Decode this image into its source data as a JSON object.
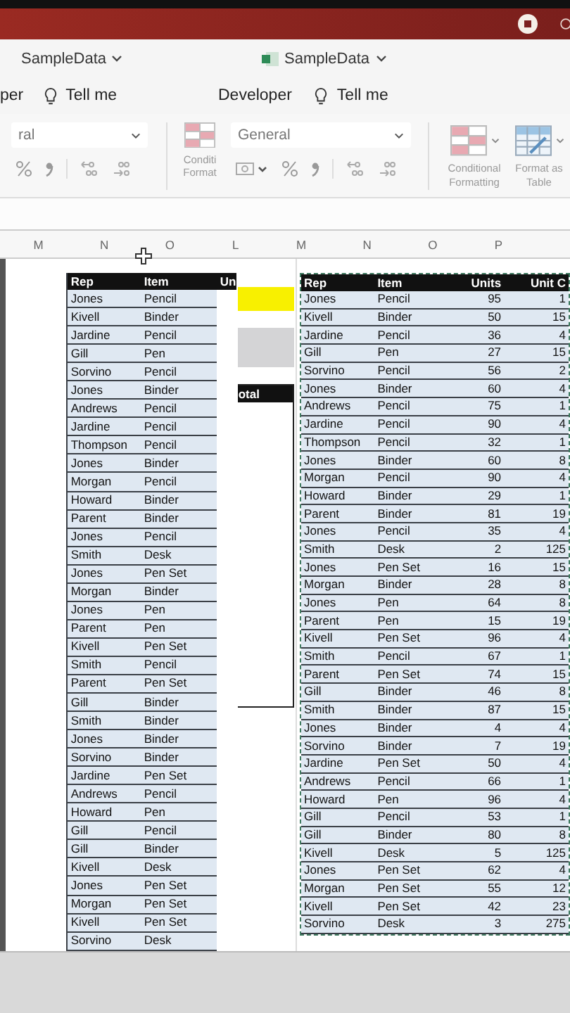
{
  "left_window": {
    "title": "SampleData",
    "tab_partial": "per",
    "tell_me": "Tell me",
    "number_format": "ral",
    "table": {
      "columns": [
        "Rep",
        "Item",
        "Un"
      ],
      "rows": [
        [
          "Jones",
          "Pencil"
        ],
        [
          "Kivell",
          "Binder"
        ],
        [
          "Jardine",
          "Pencil"
        ],
        [
          "Gill",
          "Pen"
        ],
        [
          "Sorvino",
          "Pencil"
        ],
        [
          "Jones",
          "Binder"
        ],
        [
          "Andrews",
          "Pencil"
        ],
        [
          "Jardine",
          "Pencil"
        ],
        [
          "Thompson",
          "Pencil"
        ],
        [
          "Jones",
          "Binder"
        ],
        [
          "Morgan",
          "Pencil"
        ],
        [
          "Howard",
          "Binder"
        ],
        [
          "Parent",
          "Binder"
        ],
        [
          "Jones",
          "Pencil"
        ],
        [
          "Smith",
          "Desk"
        ],
        [
          "Jones",
          "Pen Set"
        ],
        [
          "Morgan",
          "Binder"
        ],
        [
          "Jones",
          "Pen"
        ],
        [
          "Parent",
          "Pen"
        ],
        [
          "Kivell",
          "Pen Set"
        ],
        [
          "Smith",
          "Pencil"
        ],
        [
          "Parent",
          "Pen Set"
        ],
        [
          "Gill",
          "Binder"
        ],
        [
          "Smith",
          "Binder"
        ],
        [
          "Jones",
          "Binder"
        ],
        [
          "Sorvino",
          "Binder"
        ],
        [
          "Jardine",
          "Pen Set"
        ],
        [
          "Andrews",
          "Pencil"
        ],
        [
          "Howard",
          "Pen"
        ],
        [
          "Gill",
          "Pencil"
        ],
        [
          "Gill",
          "Binder"
        ],
        [
          "Kivell",
          "Desk"
        ],
        [
          "Jones",
          "Pen Set"
        ],
        [
          "Morgan",
          "Pen Set"
        ],
        [
          "Kivell",
          "Pen Set"
        ],
        [
          "Sorvino",
          "Desk"
        ]
      ]
    },
    "total_header": "otal"
  },
  "right_window": {
    "title": "SampleData",
    "tab": "Developer",
    "tell_me": "Tell me",
    "conditional_short": [
      "Conditi",
      "Format"
    ],
    "number_format": "General",
    "conditional_formatting": "Conditional Formatting",
    "format_as_table": "Format as Table",
    "table": {
      "columns": [
        "Rep",
        "Item",
        "Units",
        "Unit C"
      ],
      "rows": [
        [
          "Jones",
          "Pencil",
          "95",
          "1"
        ],
        [
          "Kivell",
          "Binder",
          "50",
          "15"
        ],
        [
          "Jardine",
          "Pencil",
          "36",
          "4"
        ],
        [
          "Gill",
          "Pen",
          "27",
          "15"
        ],
        [
          "Sorvino",
          "Pencil",
          "56",
          "2"
        ],
        [
          "Jones",
          "Binder",
          "60",
          "4"
        ],
        [
          "Andrews",
          "Pencil",
          "75",
          "1"
        ],
        [
          "Jardine",
          "Pencil",
          "90",
          "4"
        ],
        [
          "Thompson",
          "Pencil",
          "32",
          "1"
        ],
        [
          "Jones",
          "Binder",
          "60",
          "8"
        ],
        [
          "Morgan",
          "Pencil",
          "90",
          "4"
        ],
        [
          "Howard",
          "Binder",
          "29",
          "1"
        ],
        [
          "Parent",
          "Binder",
          "81",
          "19"
        ],
        [
          "Jones",
          "Pencil",
          "35",
          "4"
        ],
        [
          "Smith",
          "Desk",
          "2",
          "125"
        ],
        [
          "Jones",
          "Pen Set",
          "16",
          "15"
        ],
        [
          "Morgan",
          "Binder",
          "28",
          "8"
        ],
        [
          "Jones",
          "Pen",
          "64",
          "8"
        ],
        [
          "Parent",
          "Pen",
          "15",
          "19"
        ],
        [
          "Kivell",
          "Pen Set",
          "96",
          "4"
        ],
        [
          "Smith",
          "Pencil",
          "67",
          "1"
        ],
        [
          "Parent",
          "Pen Set",
          "74",
          "15"
        ],
        [
          "Gill",
          "Binder",
          "46",
          "8"
        ],
        [
          "Smith",
          "Binder",
          "87",
          "15"
        ],
        [
          "Jones",
          "Binder",
          "4",
          "4"
        ],
        [
          "Sorvino",
          "Binder",
          "7",
          "19"
        ],
        [
          "Jardine",
          "Pen Set",
          "50",
          "4"
        ],
        [
          "Andrews",
          "Pencil",
          "66",
          "1"
        ],
        [
          "Howard",
          "Pen",
          "96",
          "4"
        ],
        [
          "Gill",
          "Pencil",
          "53",
          "1"
        ],
        [
          "Gill",
          "Binder",
          "80",
          "8"
        ],
        [
          "Kivell",
          "Desk",
          "5",
          "125"
        ],
        [
          "Jones",
          "Pen Set",
          "62",
          "4"
        ],
        [
          "Morgan",
          "Pen Set",
          "55",
          "12"
        ],
        [
          "Kivell",
          "Pen Set",
          "42",
          "23"
        ],
        [
          "Sorvino",
          "Desk",
          "3",
          "275"
        ]
      ]
    }
  },
  "column_headers": [
    "M",
    "N",
    "O",
    "L",
    "M",
    "N",
    "O",
    "P"
  ]
}
